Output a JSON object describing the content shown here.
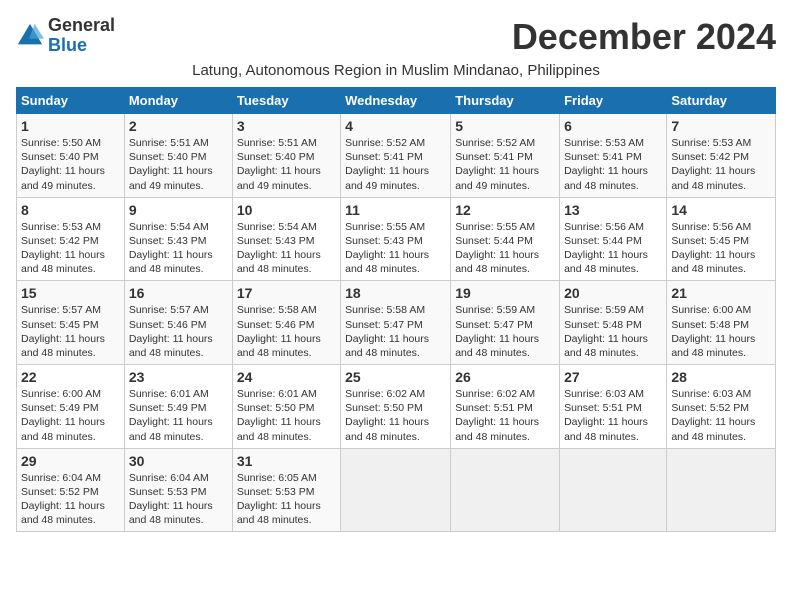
{
  "logo": {
    "general": "General",
    "blue": "Blue"
  },
  "title": "December 2024",
  "subtitle": "Latung, Autonomous Region in Muslim Mindanao, Philippines",
  "headers": [
    "Sunday",
    "Monday",
    "Tuesday",
    "Wednesday",
    "Thursday",
    "Friday",
    "Saturday"
  ],
  "weeks": [
    [
      {
        "day": "1",
        "sunrise": "5:50 AM",
        "sunset": "5:40 PM",
        "daylight": "11 hours and 49 minutes."
      },
      {
        "day": "2",
        "sunrise": "5:51 AM",
        "sunset": "5:40 PM",
        "daylight": "11 hours and 49 minutes."
      },
      {
        "day": "3",
        "sunrise": "5:51 AM",
        "sunset": "5:40 PM",
        "daylight": "11 hours and 49 minutes."
      },
      {
        "day": "4",
        "sunrise": "5:52 AM",
        "sunset": "5:41 PM",
        "daylight": "11 hours and 49 minutes."
      },
      {
        "day": "5",
        "sunrise": "5:52 AM",
        "sunset": "5:41 PM",
        "daylight": "11 hours and 49 minutes."
      },
      {
        "day": "6",
        "sunrise": "5:53 AM",
        "sunset": "5:41 PM",
        "daylight": "11 hours and 48 minutes."
      },
      {
        "day": "7",
        "sunrise": "5:53 AM",
        "sunset": "5:42 PM",
        "daylight": "11 hours and 48 minutes."
      }
    ],
    [
      {
        "day": "8",
        "sunrise": "5:53 AM",
        "sunset": "5:42 PM",
        "daylight": "11 hours and 48 minutes."
      },
      {
        "day": "9",
        "sunrise": "5:54 AM",
        "sunset": "5:43 PM",
        "daylight": "11 hours and 48 minutes."
      },
      {
        "day": "10",
        "sunrise": "5:54 AM",
        "sunset": "5:43 PM",
        "daylight": "11 hours and 48 minutes."
      },
      {
        "day": "11",
        "sunrise": "5:55 AM",
        "sunset": "5:43 PM",
        "daylight": "11 hours and 48 minutes."
      },
      {
        "day": "12",
        "sunrise": "5:55 AM",
        "sunset": "5:44 PM",
        "daylight": "11 hours and 48 minutes."
      },
      {
        "day": "13",
        "sunrise": "5:56 AM",
        "sunset": "5:44 PM",
        "daylight": "11 hours and 48 minutes."
      },
      {
        "day": "14",
        "sunrise": "5:56 AM",
        "sunset": "5:45 PM",
        "daylight": "11 hours and 48 minutes."
      }
    ],
    [
      {
        "day": "15",
        "sunrise": "5:57 AM",
        "sunset": "5:45 PM",
        "daylight": "11 hours and 48 minutes."
      },
      {
        "day": "16",
        "sunrise": "5:57 AM",
        "sunset": "5:46 PM",
        "daylight": "11 hours and 48 minutes."
      },
      {
        "day": "17",
        "sunrise": "5:58 AM",
        "sunset": "5:46 PM",
        "daylight": "11 hours and 48 minutes."
      },
      {
        "day": "18",
        "sunrise": "5:58 AM",
        "sunset": "5:47 PM",
        "daylight": "11 hours and 48 minutes."
      },
      {
        "day": "19",
        "sunrise": "5:59 AM",
        "sunset": "5:47 PM",
        "daylight": "11 hours and 48 minutes."
      },
      {
        "day": "20",
        "sunrise": "5:59 AM",
        "sunset": "5:48 PM",
        "daylight": "11 hours and 48 minutes."
      },
      {
        "day": "21",
        "sunrise": "6:00 AM",
        "sunset": "5:48 PM",
        "daylight": "11 hours and 48 minutes."
      }
    ],
    [
      {
        "day": "22",
        "sunrise": "6:00 AM",
        "sunset": "5:49 PM",
        "daylight": "11 hours and 48 minutes."
      },
      {
        "day": "23",
        "sunrise": "6:01 AM",
        "sunset": "5:49 PM",
        "daylight": "11 hours and 48 minutes."
      },
      {
        "day": "24",
        "sunrise": "6:01 AM",
        "sunset": "5:50 PM",
        "daylight": "11 hours and 48 minutes."
      },
      {
        "day": "25",
        "sunrise": "6:02 AM",
        "sunset": "5:50 PM",
        "daylight": "11 hours and 48 minutes."
      },
      {
        "day": "26",
        "sunrise": "6:02 AM",
        "sunset": "5:51 PM",
        "daylight": "11 hours and 48 minutes."
      },
      {
        "day": "27",
        "sunrise": "6:03 AM",
        "sunset": "5:51 PM",
        "daylight": "11 hours and 48 minutes."
      },
      {
        "day": "28",
        "sunrise": "6:03 AM",
        "sunset": "5:52 PM",
        "daylight": "11 hours and 48 minutes."
      }
    ],
    [
      {
        "day": "29",
        "sunrise": "6:04 AM",
        "sunset": "5:52 PM",
        "daylight": "11 hours and 48 minutes."
      },
      {
        "day": "30",
        "sunrise": "6:04 AM",
        "sunset": "5:53 PM",
        "daylight": "11 hours and 48 minutes."
      },
      {
        "day": "31",
        "sunrise": "6:05 AM",
        "sunset": "5:53 PM",
        "daylight": "11 hours and 48 minutes."
      },
      null,
      null,
      null,
      null
    ]
  ]
}
